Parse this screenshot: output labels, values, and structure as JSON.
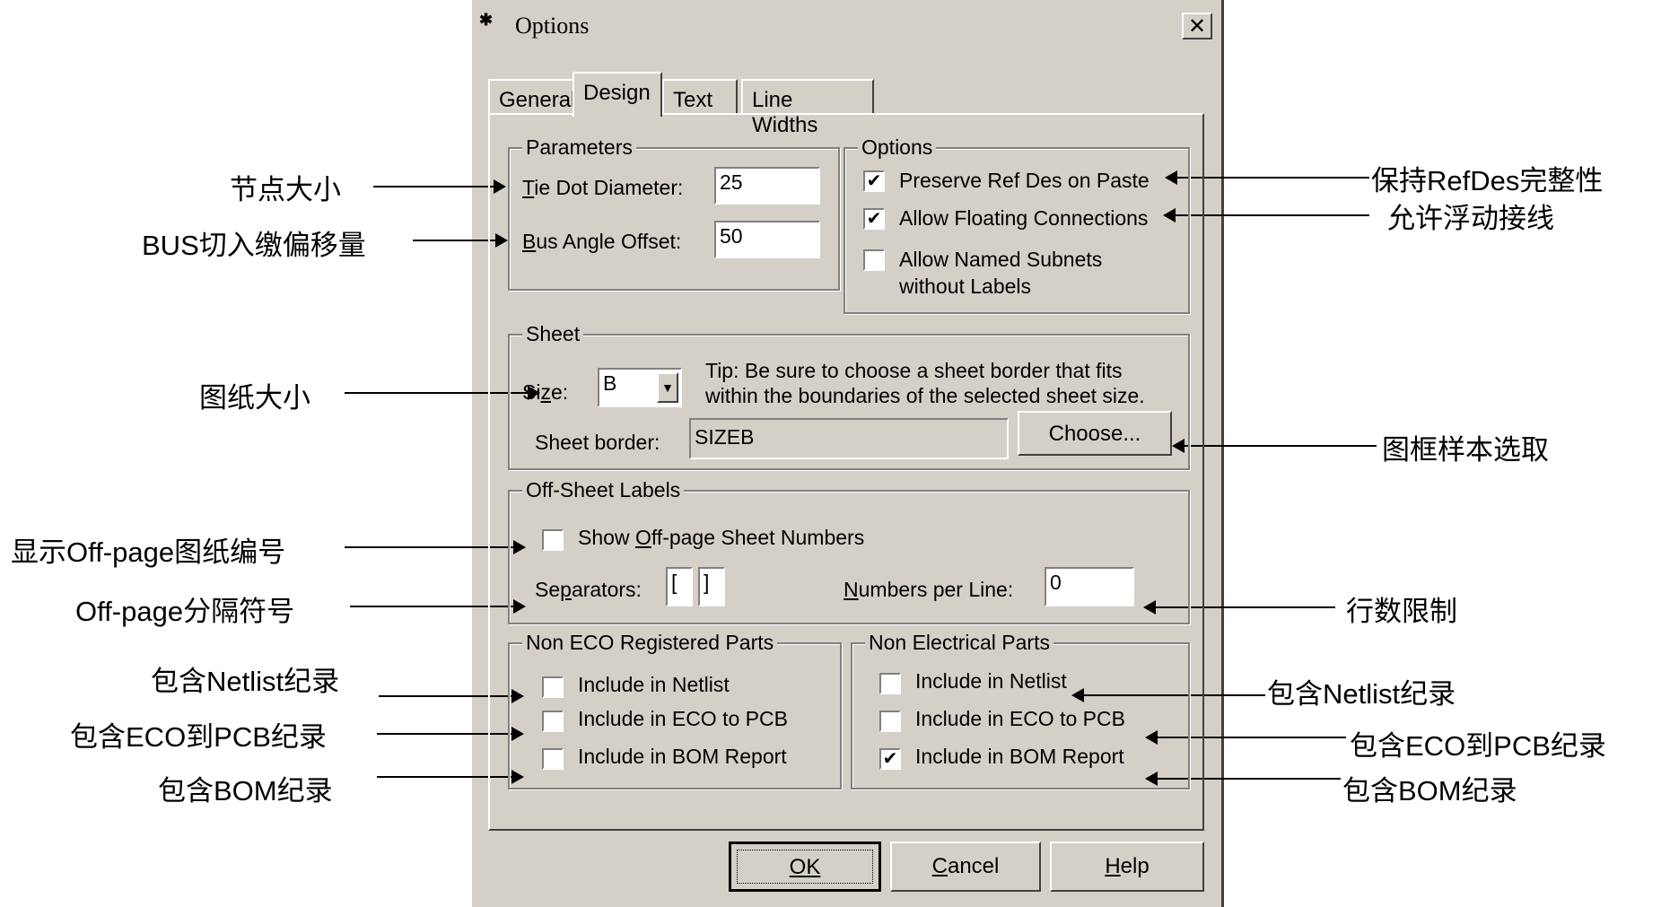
{
  "window": {
    "title": "Options",
    "close_glyph": "✕"
  },
  "tabs": [
    "General",
    "Design",
    "Text",
    "Line Widths"
  ],
  "parameters": {
    "group": "Parameters",
    "tie_dot_label_u": "T",
    "tie_dot_label": "ie Dot Diameter:",
    "tie_dot_value": "25",
    "bus_angle_label_u": "B",
    "bus_angle_label": "us Angle Offset:",
    "bus_angle_value": "50"
  },
  "options": {
    "group": "Options",
    "items": [
      {
        "label": "Preserve Ref Des on Paste",
        "checked": "✔"
      },
      {
        "label": "Allow Floating Connections",
        "checked": "✔"
      },
      {
        "label": "Allow Named Subnets",
        "label2": "without Labels",
        "checked": ""
      }
    ]
  },
  "sheet": {
    "group": "Sheet",
    "size_label_a": "Si",
    "size_label_u": "z",
    "size_label_b": "e:",
    "size_value": "B",
    "tip_line1": "Tip: Be sure to choose a sheet border that fits",
    "tip_line2": "within the boundaries of the selected sheet size.",
    "border_label": "Sheet border:",
    "border_value": "SIZEB",
    "choose_button": "Choose..."
  },
  "offsheet": {
    "group": "Off-Sheet Labels",
    "show_a": "Show ",
    "show_u": "O",
    "show_b": "ff-page Sheet Numbers",
    "sep_a": "Se",
    "sep_u": "p",
    "sep_b": "arators:",
    "sep_left": "[",
    "sep_right": "]",
    "npl_u": "N",
    "npl_b": "umbers per Line:",
    "npl_value": "0"
  },
  "non_eco": {
    "group": "Non ECO Registered Parts",
    "items": [
      {
        "label": "Include in Netlist",
        "checked": ""
      },
      {
        "label": "Include in ECO to PCB",
        "checked": ""
      },
      {
        "label": "Include in BOM Report",
        "checked": ""
      }
    ]
  },
  "non_elec": {
    "group": "Non Electrical Parts",
    "items": [
      {
        "label": "Include in Netlist",
        "checked": ""
      },
      {
        "label": "Include in ECO to PCB",
        "checked": ""
      },
      {
        "label": "Include in BOM Report",
        "checked": "✔"
      }
    ]
  },
  "buttons": {
    "ok": "OK",
    "cancel_u": "C",
    "cancel_b": "ancel",
    "help_u": "H",
    "help_b": "elp"
  },
  "annotations": {
    "tie_dot": "节点大小",
    "bus_angle": "BUS切入缴偏移量",
    "size": "图纸大小",
    "show_offpage": "显示Off-page图纸编号",
    "separators": "Off-page分隔符号",
    "left_netlist": "包含Netlist纪录",
    "left_eco": "包含ECO到PCB纪录",
    "left_bom": "包含BOM纪录",
    "preserve": "保持RefDes完整性",
    "floating": "允许浮动接线",
    "choose": "图框样本选取",
    "npl": "行数限制",
    "right_netlist": "包含Netlist纪录",
    "right_eco": "包含ECO到PCB纪录",
    "right_bom": "包含BOM纪录"
  }
}
